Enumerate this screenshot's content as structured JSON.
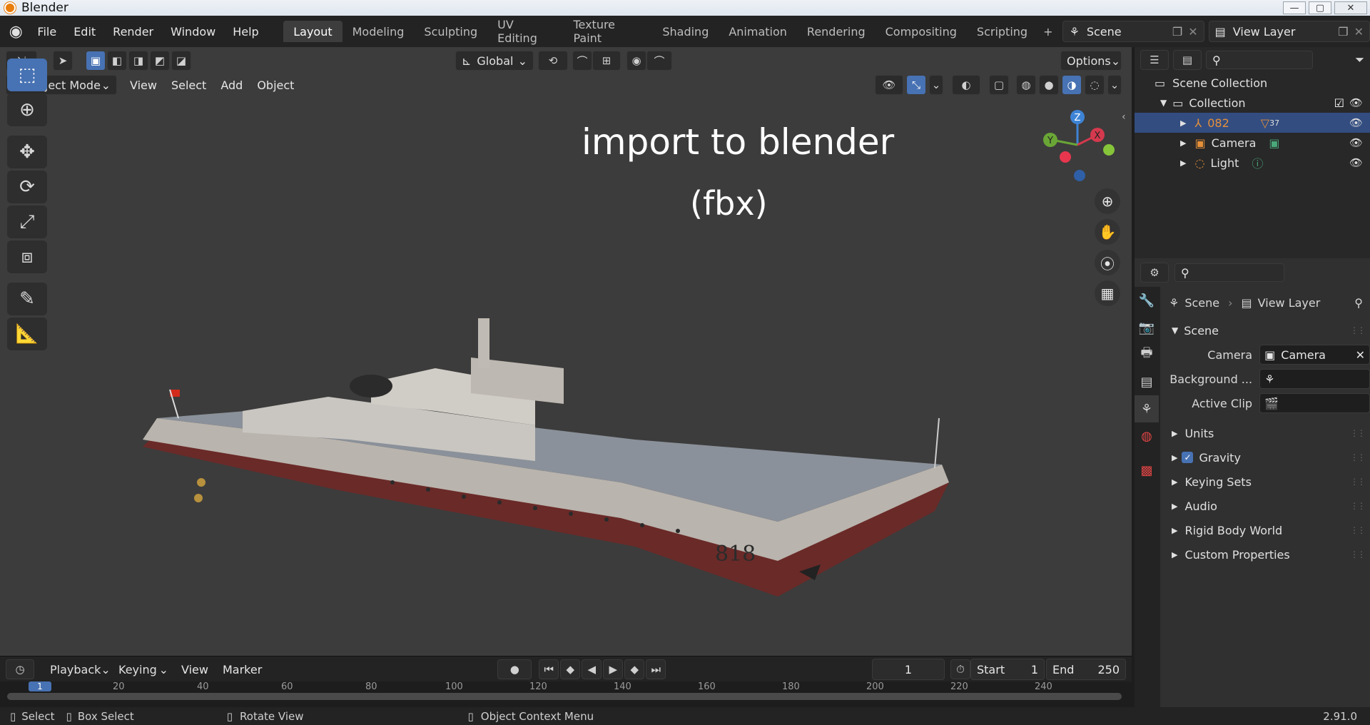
{
  "window": {
    "title": "Blender",
    "min": "—",
    "max": "▢",
    "close": "✕"
  },
  "menubar": {
    "menus": [
      "File",
      "Edit",
      "Render",
      "Window",
      "Help"
    ],
    "workspaces": [
      "Layout",
      "Modeling",
      "Sculpting",
      "UV Editing",
      "Texture Paint",
      "Shading",
      "Animation",
      "Rendering",
      "Compositing",
      "Scripting"
    ],
    "add_workspace": "+",
    "scene_name": "Scene",
    "view_layer": "View Layer"
  },
  "viewport_header": {
    "transform_orientation": "Global",
    "options_label": "Options",
    "mode": "Object Mode",
    "menus": [
      "View",
      "Select",
      "Add",
      "Object"
    ]
  },
  "overlay_text": {
    "line1": "import to blender",
    "line2": "(fbx)"
  },
  "gizmo": {
    "x": "X",
    "y": "Y",
    "z": "Z"
  },
  "ship": {
    "hull_number": "818"
  },
  "timeline": {
    "menus": [
      "Playback",
      "Keying",
      "View",
      "Marker"
    ],
    "current_frame": "1",
    "start_label": "Start",
    "start_value": "1",
    "end_label": "End",
    "end_value": "250",
    "ruler": [
      "1",
      "20",
      "40",
      "60",
      "80",
      "100",
      "120",
      "140",
      "160",
      "180",
      "200",
      "220",
      "240"
    ]
  },
  "statusbar": {
    "select": "Select",
    "box_select": "Box Select",
    "rotate_view": "Rotate View",
    "context_menu": "Object Context Menu",
    "version": "2.91.0"
  },
  "outliner": {
    "root": "Scene Collection",
    "collection": "Collection",
    "items": [
      {
        "name": "082",
        "badge": "37"
      },
      {
        "name": "Camera",
        "badge": ""
      },
      {
        "name": "Light",
        "badge": ""
      }
    ]
  },
  "properties": {
    "breadcrumb_scene": "Scene",
    "breadcrumb_layer": "View Layer",
    "panel_title": "Scene",
    "camera_label": "Camera",
    "camera_value": "Camera",
    "background_label": "Background ...",
    "active_clip_label": "Active Clip",
    "subpanels": [
      "Units",
      "Gravity",
      "Keying Sets",
      "Audio",
      "Rigid Body World",
      "Custom Properties"
    ]
  },
  "colors": {
    "accent": "#4772b3",
    "viewport_bg": "#3c3c3c",
    "selected_row": "#334d80",
    "object_orange": "#e5903a"
  }
}
